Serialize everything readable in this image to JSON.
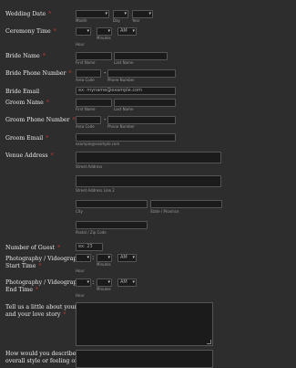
{
  "wedding_date": {
    "label": "Wedding Date",
    "month_sub": "Month",
    "day_sub": "Day",
    "year_sub": "Year"
  },
  "ceremony_time": {
    "label": "Ceremony Time",
    "ampm": "AM",
    "hour_sub": "Hour",
    "minutes_sub": "Minutes"
  },
  "bride_name": {
    "label": "Bride Name",
    "first_sub": "First Name",
    "last_sub": "Last Name"
  },
  "bride_phone": {
    "label": "Bride Phone Number",
    "area_sub": "Area Code",
    "phone_sub": "Phone Number",
    "sep": "-"
  },
  "bride_email": {
    "label": "Bride Email",
    "placeholder": "ex: myname@example.com"
  },
  "groom_name": {
    "label": "Groom Name",
    "first_sub": "First Name",
    "last_sub": "Last Name"
  },
  "groom_phone": {
    "label": "Groom Phone Number",
    "area_sub": "Area Code",
    "phone_sub": "Phone Number",
    "sep": "-"
  },
  "groom_email": {
    "label": "Groom Email",
    "sub": "example@example.com"
  },
  "venue_address": {
    "label": "Venue Address",
    "street_sub": "Street Address",
    "street2_sub": "Street Address Line 2",
    "city_sub": "City",
    "state_sub": "State / Province",
    "postal_sub": "Postal / Zip Code"
  },
  "guests": {
    "label": "Number of Guest",
    "placeholder": "ex: 23"
  },
  "photo_start": {
    "label_line1": "Photography / Videography",
    "label_line2": "Start Time",
    "ampm": "AM",
    "hour_sub": "Hour",
    "minutes_sub": "Minutes",
    "colon": ":"
  },
  "photo_end": {
    "label_line1": "Photography / Videography",
    "label_line2": "End Time",
    "ampm": "AM",
    "hour_sub": "Hour",
    "minutes_sub": "Minutes",
    "colon": ":"
  },
  "love_story": {
    "label_line1": "Tell us a little about yourself",
    "label_line2": "and your love story"
  },
  "style": {
    "label_line1": "How would you describe the",
    "label_line2": "overall style or feeling of your"
  },
  "required_mark": "*"
}
